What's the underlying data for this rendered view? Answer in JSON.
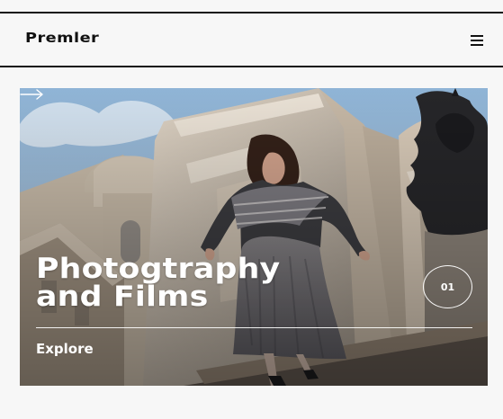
{
  "header": {
    "logo": "Premler",
    "menu_icon": "hamburger-menu-icon"
  },
  "hero": {
    "title_line1": "Photogtraphy",
    "title_line2": "and Films",
    "counter": "01",
    "cta": "Explore",
    "arrow_icon": "right-arrow-icon"
  },
  "colors": {
    "background": "#f7f7f7",
    "text_dark": "#111111",
    "hero_text": "#ffffff",
    "sky": "#9fc0dc",
    "stone": "#d8c8b2"
  }
}
